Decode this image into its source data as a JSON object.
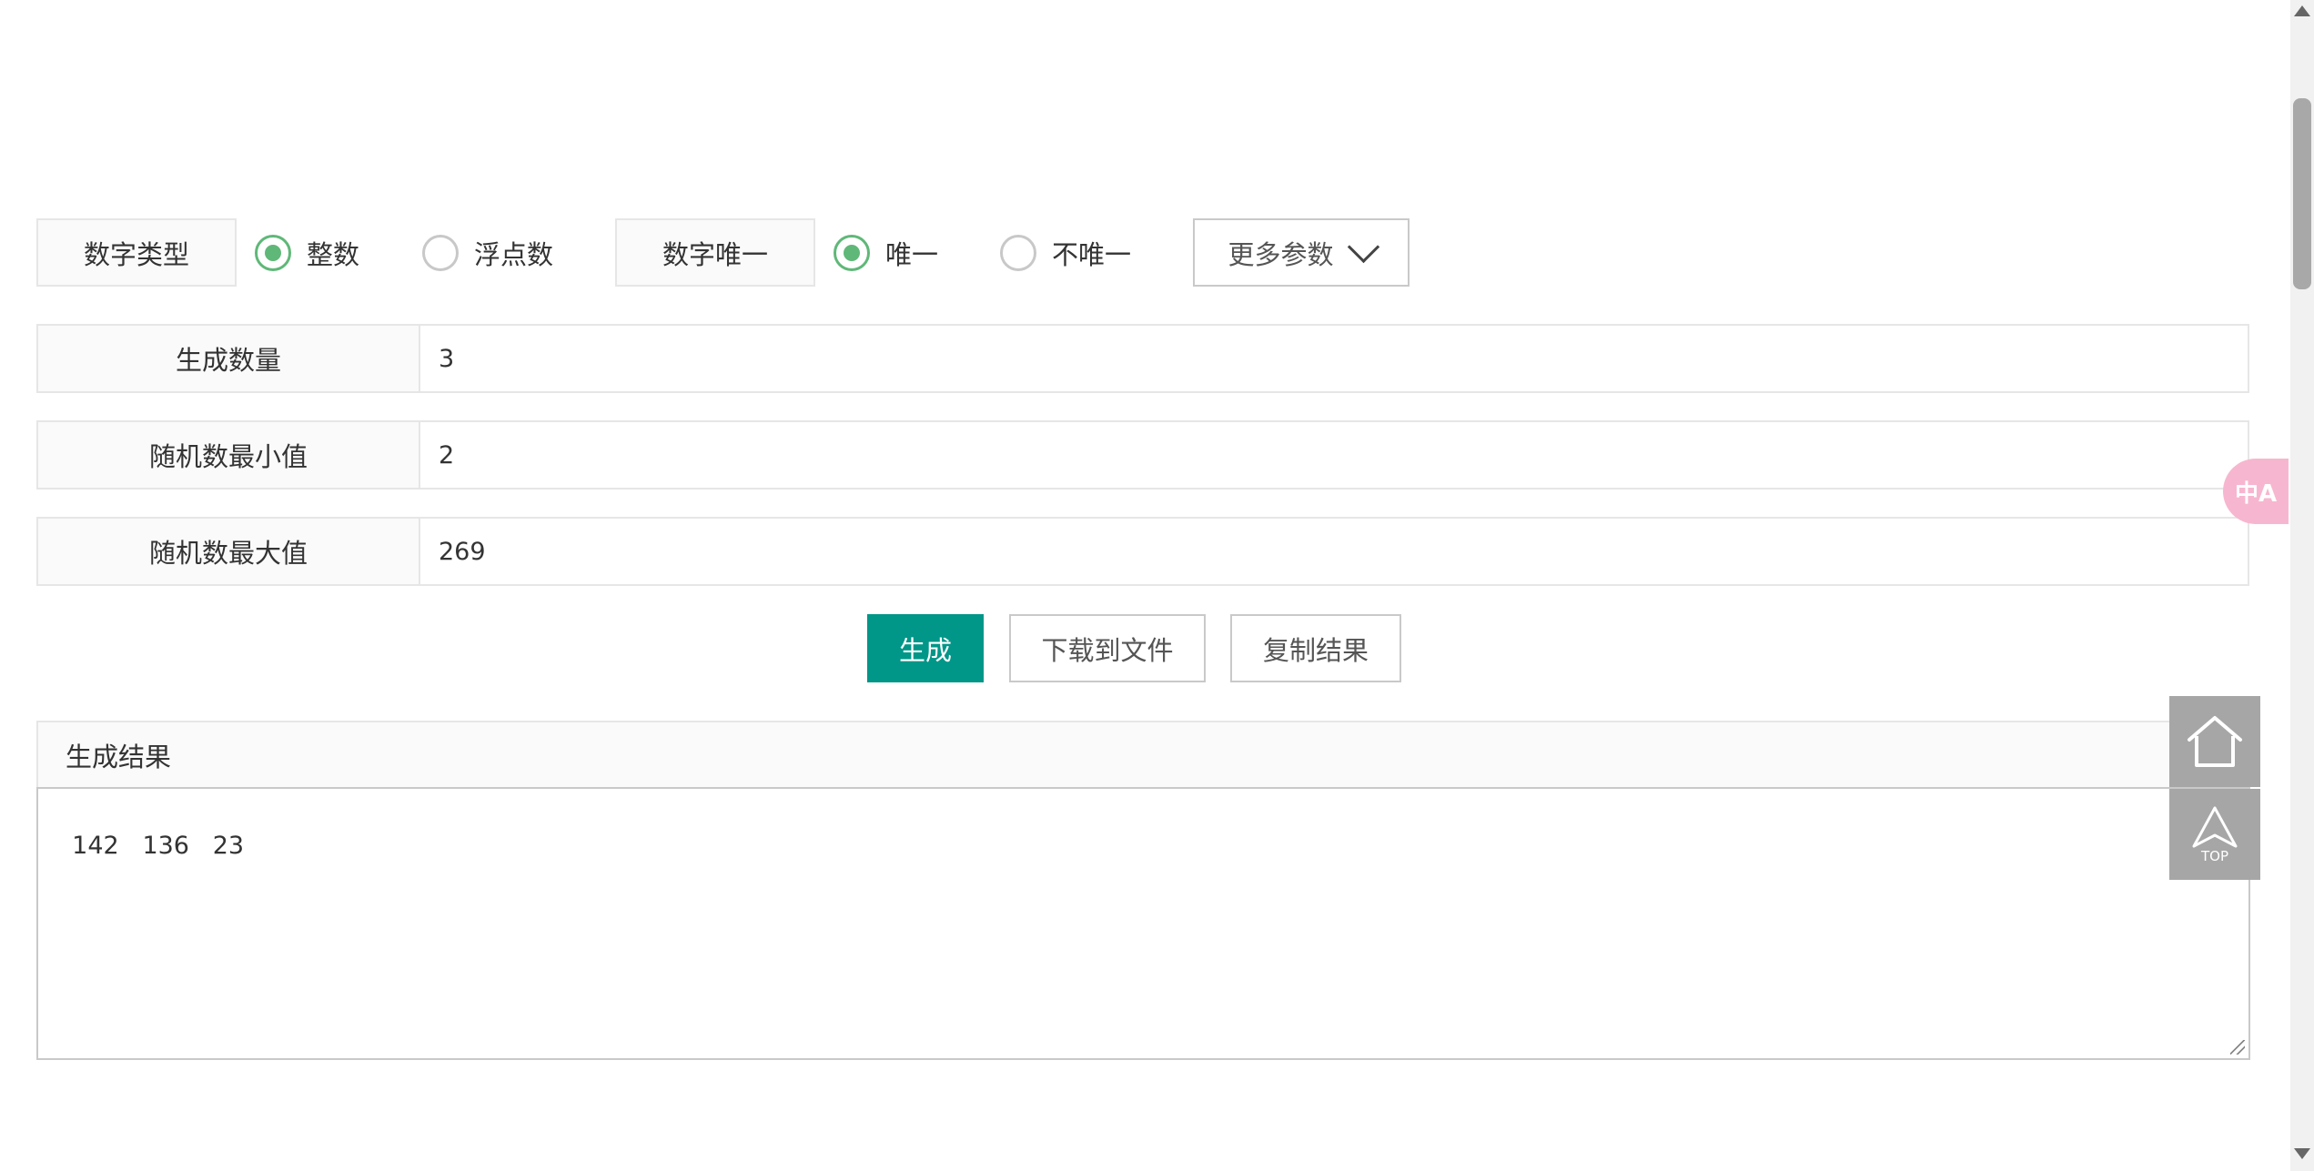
{
  "options": {
    "number_type_label": "数字类型",
    "integer_label": "整数",
    "float_label": "浮点数",
    "unique_label": "数字唯一",
    "unique_yes_label": "唯一",
    "unique_no_label": "不唯一",
    "more_params_label": "更多参数"
  },
  "fields": {
    "count_label": "生成数量",
    "count_value": "3",
    "min_label": "随机数最小值",
    "min_value": "2",
    "max_label": "随机数最大值",
    "max_value": "269"
  },
  "actions": {
    "generate_label": "生成",
    "download_label": "下载到文件",
    "copy_label": "复制结果"
  },
  "result": {
    "title": "生成结果",
    "text": "142   136   23"
  },
  "side": {
    "translate_glyph": "中A",
    "top_text": "TOP"
  },
  "colors": {
    "primary": "#009688",
    "radio_checked": "#5fb878",
    "side_button": "#a6a6a6"
  }
}
